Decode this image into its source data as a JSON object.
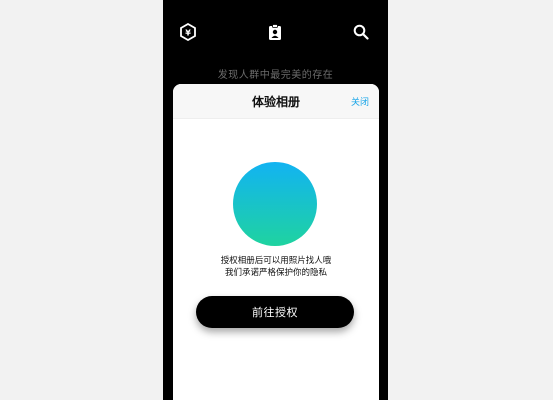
{
  "top_bar": {
    "left_icon": "yen-hexagon-icon",
    "center_icon": "id-badge-icon",
    "right_icon": "search-icon"
  },
  "tagline": "发现人群中最完美的存在",
  "sheet": {
    "title": "体验相册",
    "close_label": "关闭",
    "description_lines": [
      "授权相册后可以用照片找人哦",
      "我们承诺严格保护你的隐私"
    ],
    "button_label": "前往授权"
  },
  "colors": {
    "accent": "#16a4e8",
    "gradient_top": "#12b3f2",
    "gradient_bottom": "#1fd3a0",
    "background": "#000000"
  }
}
